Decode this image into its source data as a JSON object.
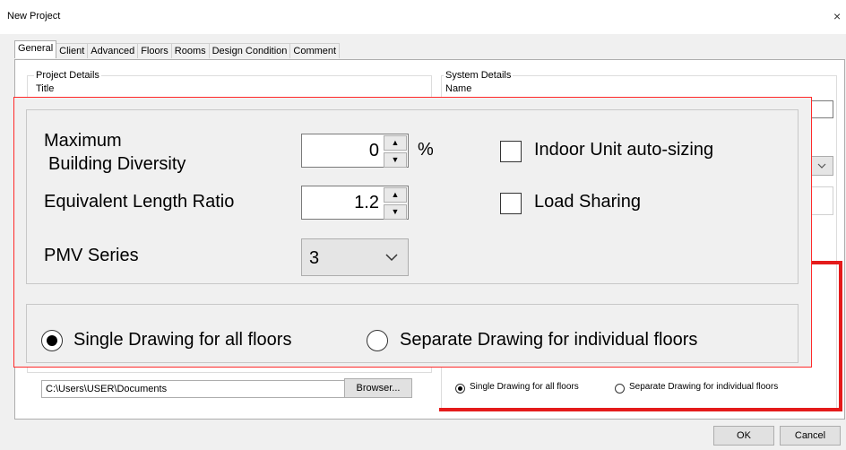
{
  "window": {
    "title": "New Project",
    "close_glyph": "×"
  },
  "tabs": [
    {
      "label": "General",
      "active": true
    },
    {
      "label": "Client"
    },
    {
      "label": "Advanced"
    },
    {
      "label": "Floors"
    },
    {
      "label": "Rooms"
    },
    {
      "label": "Design Condition"
    },
    {
      "label": "Comment"
    }
  ],
  "project_details": {
    "group_label": "Project Details",
    "title_label": "Title"
  },
  "system_details": {
    "group_label": "System Details",
    "name_label": "Name"
  },
  "zoom": {
    "max_diversity_label_line1": "Maximum",
    "max_diversity_label_line2": "Building Diversity",
    "max_diversity_value": "0",
    "max_diversity_unit": "%",
    "equiv_length_label": "Equivalent Length Ratio",
    "equiv_length_value": "1.2",
    "pmv_series_label": "PMV Series",
    "pmv_series_value": "3",
    "indoor_autosizing_label": "Indoor Unit auto-sizing",
    "indoor_autosizing_checked": false,
    "load_sharing_label": "Load Sharing",
    "load_sharing_checked": false,
    "single_drawing_label": "Single Drawing for all floors",
    "separate_drawing_label": "Separate Drawing for individual floors",
    "drawing_selected": "single"
  },
  "path": {
    "value": "C:\\Users\\USER\\Documents",
    "browse_label": "Browser..."
  },
  "small_drawing": {
    "single_label": "Single Drawing for all floors",
    "separate_label": "Separate Drawing for individual floors"
  },
  "buttons": {
    "ok": "OK",
    "cancel": "Cancel"
  },
  "colors": {
    "highlight_red": "#e41b1b",
    "overlay_border": "#ff2a2a"
  }
}
